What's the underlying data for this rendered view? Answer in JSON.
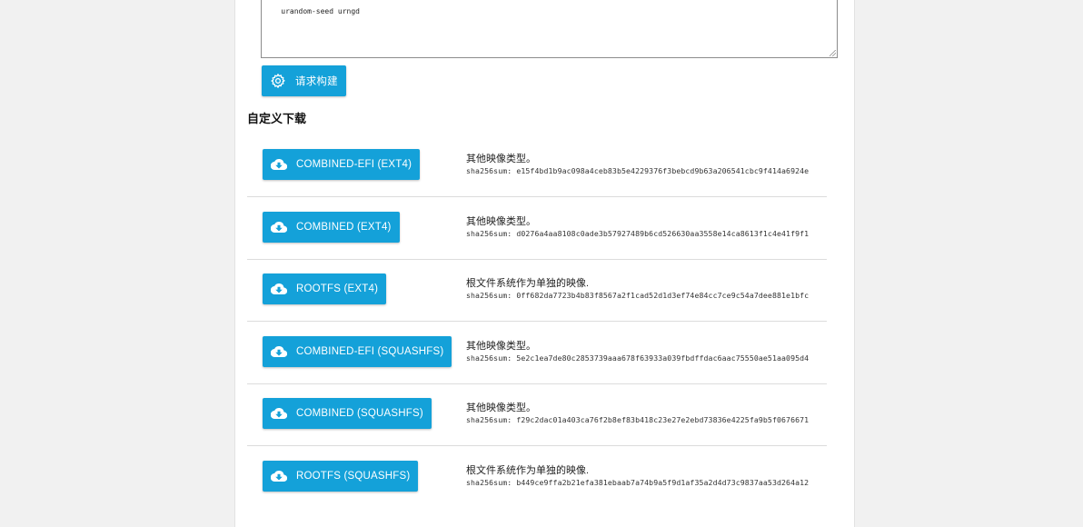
{
  "build": {
    "packages_text": "urandom-seed urngd",
    "request_button_label": "请求构建"
  },
  "custom_downloads": {
    "title": "自定义下载",
    "items": [
      {
        "label": "COMBINED-EFI (EXT4)",
        "description": "其他映像类型。",
        "sha": "sha256sum: e15f4bd1b9ac098a4ceb83b5e4229376f3bebcd9b63a206541cbc9f414a6924e"
      },
      {
        "label": "COMBINED (EXT4)",
        "description": "其他映像类型。",
        "sha": "sha256sum: d0276a4aa8108c0ade3b57927489b6cd526630aa3558e14ca8613f1c4e41f9f1"
      },
      {
        "label": "ROOTFS (EXT4)",
        "description": "根文件系统作为单独的映像.",
        "sha": "sha256sum: 0ff682da7723b4b83f8567a2f1cad52d1d3ef74e84cc7ce9c54a7dee881e1bfc"
      },
      {
        "label": "COMBINED-EFI (SQUASHFS)",
        "description": "其他映像类型。",
        "sha": "sha256sum: 5e2c1ea7de80c2853739aaa678f63933a039fbdffdac6aac75550ae51aa095d4"
      },
      {
        "label": "COMBINED (SQUASHFS)",
        "description": "其他映像类型。",
        "sha": "sha256sum: f29c2dac01a403ca76f2b8ef83b418c23e27e2ebd73836e4225fa9b5f0676671"
      },
      {
        "label": "ROOTFS (SQUASHFS)",
        "description": "根文件系统作为单独的映像.",
        "sha": "sha256sum: b449ce9ffa2b21efa381ebaab7a74b9a5f9d1af35a2d4d73c9837aa53d264a12"
      }
    ]
  },
  "colors": {
    "accent": "#14a1d9",
    "background": "#f1f1f1"
  },
  "icons": {
    "request_button": "gear-icon",
    "download_button": "cloud-download-icon"
  }
}
